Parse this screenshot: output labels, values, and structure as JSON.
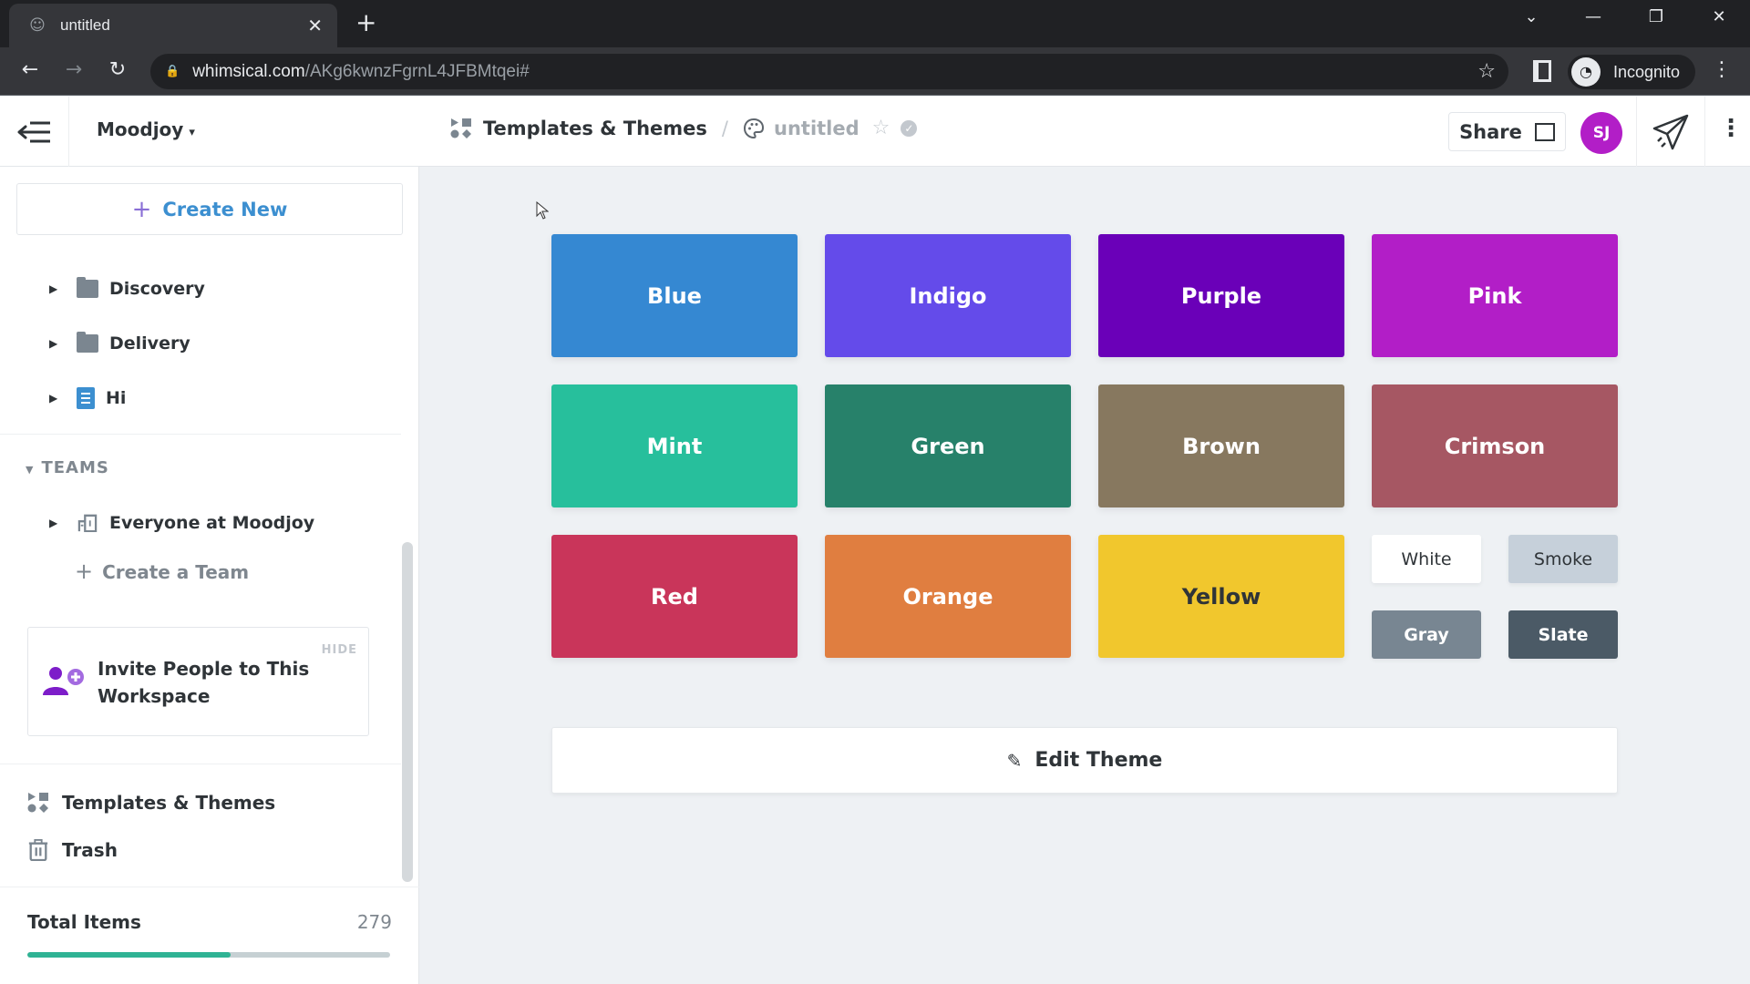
{
  "browser": {
    "tab_title": "untitled",
    "tab_icon": "palette-icon",
    "url_host": "whimsical.com",
    "url_path": "/AKg6kwnzFgrnL4JFBMtqei#",
    "profile_label": "Incognito"
  },
  "header": {
    "workspace": "Moodjoy",
    "breadcrumb_section": "Templates & Themes",
    "breadcrumb_separator": "/",
    "document_title": "untitled",
    "share_label": "Share",
    "avatar_initials": "SJ"
  },
  "sidebar": {
    "create_new_label": "Create New",
    "items": [
      {
        "label": "Discovery",
        "icon": "folder-icon"
      },
      {
        "label": "Delivery",
        "icon": "folder-icon"
      },
      {
        "label": "Hi",
        "icon": "document-icon"
      }
    ],
    "teams_heading": "TEAMS",
    "team_items": [
      {
        "label": "Everyone at Moodjoy",
        "icon": "building-icon"
      }
    ],
    "create_team_label": "Create a Team",
    "invite_card": {
      "hide_label": "HIDE",
      "text": "Invite People to This Workspace"
    },
    "bottom_items": [
      {
        "label": "Templates & Themes",
        "icon": "shapes-icon"
      },
      {
        "label": "Trash",
        "icon": "trash-icon"
      }
    ],
    "total_items_label": "Total Items",
    "total_items_count": "279",
    "usage_fraction": 0.56
  },
  "theme": {
    "swatches": [
      {
        "label": "Blue",
        "color": "#3588d2",
        "text_color": "#ffffff"
      },
      {
        "label": "Indigo",
        "color": "#644bea",
        "text_color": "#ffffff"
      },
      {
        "label": "Purple",
        "color": "#6a00b8",
        "text_color": "#ffffff"
      },
      {
        "label": "Pink",
        "color": "#b21ec7",
        "text_color": "#ffffff"
      },
      {
        "label": "Mint",
        "color": "#27bf9c",
        "text_color": "#ffffff"
      },
      {
        "label": "Green",
        "color": "#27816a",
        "text_color": "#ffffff"
      },
      {
        "label": "Brown",
        "color": "#87785f",
        "text_color": "#ffffff"
      },
      {
        "label": "Crimson",
        "color": "#a65763",
        "text_color": "#ffffff"
      },
      {
        "label": "Red",
        "color": "#c9355a",
        "text_color": "#ffffff"
      },
      {
        "label": "Orange",
        "color": "#e07e40",
        "text_color": "#ffffff"
      },
      {
        "label": "Yellow",
        "color": "#f1c72d",
        "text_color": "#2f3438"
      }
    ],
    "neutrals": [
      {
        "label": "White",
        "color": "#ffffff",
        "text_color": "#2f3438"
      },
      {
        "label": "Smoke",
        "color": "#c6d0da",
        "text_color": "#2f3438"
      },
      {
        "label": "Gray",
        "color": "#788692",
        "text_color": "#ffffff"
      },
      {
        "label": "Slate",
        "color": "#4b5a66",
        "text_color": "#ffffff"
      }
    ],
    "edit_label": "Edit Theme"
  }
}
